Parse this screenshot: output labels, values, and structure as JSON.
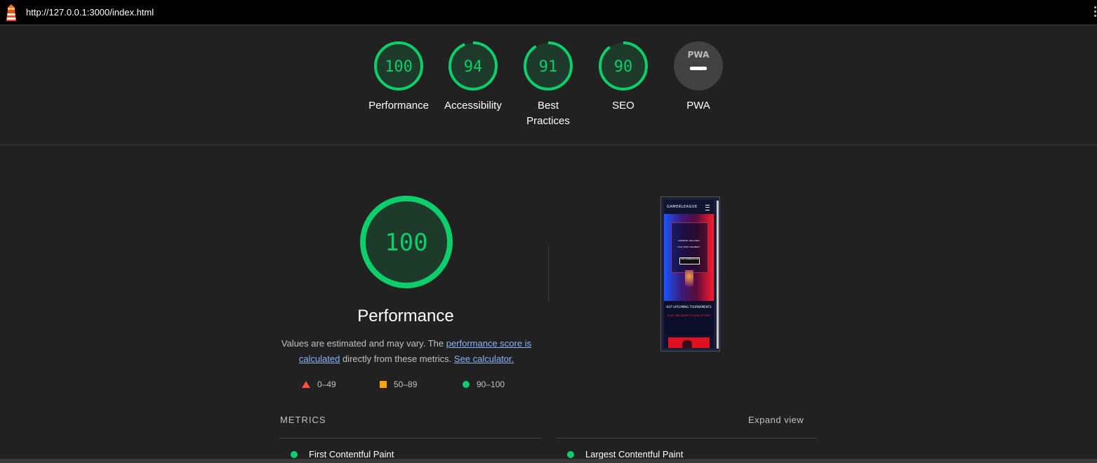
{
  "address_bar": {
    "url": "http://127.0.0.1:3000/index.html"
  },
  "colors": {
    "pass": "#0cce6b",
    "average": "#ffa400",
    "fail": "#ff4e42",
    "neutral": "#424242",
    "background": "#212121"
  },
  "categories": [
    {
      "label": "Performance",
      "score": 100
    },
    {
      "label": "Accessibility",
      "score": 94
    },
    {
      "label": "Best\nPractices",
      "score": 91
    },
    {
      "label": "SEO",
      "score": 90
    },
    {
      "label": "PWA",
      "score": null,
      "badge": "PWA"
    }
  ],
  "performance": {
    "score": "100",
    "title": "Performance",
    "desc_prefix": "Values are estimated and may vary. The ",
    "link_score": "performance score is calculated",
    "desc_middle": " directly from these metrics. ",
    "link_calc": "See calculator."
  },
  "legend": [
    {
      "icon": "triangle-icon",
      "range": "0–49"
    },
    {
      "icon": "square-icon",
      "range": "50–89"
    },
    {
      "icon": "circle-icon",
      "range": "90–100"
    }
  ],
  "thumbnail": {
    "brand": "GAMERLEAGUE",
    "hero_line1": "COMPETE THE ONES.",
    "hero_line2": "PLAY WITH THE BEST.",
    "hero_button": "JOIN GAMERLEAGUE",
    "section_title": "HOT UPCOMING TOURNAMENTS",
    "section_sub": "CLICK THE GAMES TO SIGN UP FIRST"
  },
  "metrics": {
    "heading": "METRICS",
    "expand_label": "Expand view",
    "items": [
      {
        "label": "First Contentful Paint"
      },
      {
        "label": "Largest Contentful Paint"
      }
    ]
  }
}
